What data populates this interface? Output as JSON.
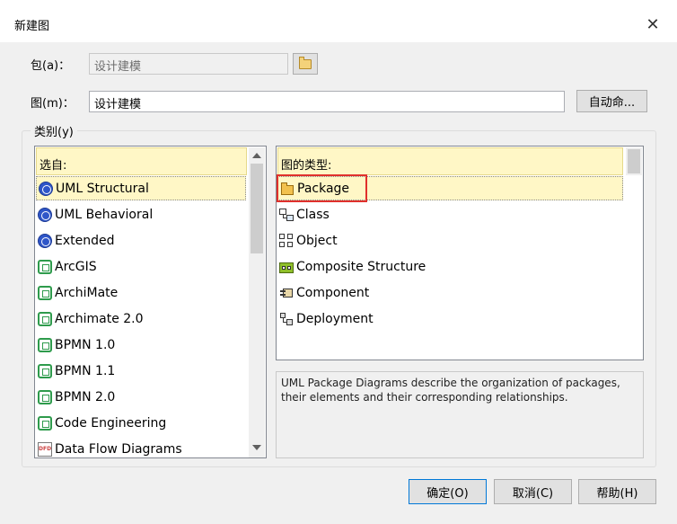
{
  "dialog": {
    "title": "新建图",
    "close_symbol": "✕"
  },
  "package": {
    "label": "包(a)：",
    "value": "设计建模"
  },
  "diagram": {
    "label": "图(m)：",
    "value": "设计建模",
    "auto_name_button": "自动命..."
  },
  "category": {
    "group_label": "类别(y)",
    "select_header": "选自:",
    "items": [
      {
        "label": "UML Structural",
        "icon": "uml-circle-icon",
        "selected": true
      },
      {
        "label": "UML Behavioral",
        "icon": "uml-circle-icon"
      },
      {
        "label": "Extended",
        "icon": "uml-circle-icon"
      },
      {
        "label": "ArcGIS",
        "icon": "technology-icon"
      },
      {
        "label": "ArchiMate",
        "icon": "technology-icon"
      },
      {
        "label": "Archimate 2.0",
        "icon": "technology-icon"
      },
      {
        "label": "BPMN 1.0",
        "icon": "technology-icon"
      },
      {
        "label": "BPMN 1.1",
        "icon": "technology-icon"
      },
      {
        "label": "BPMN 2.0",
        "icon": "technology-icon"
      },
      {
        "label": "Code Engineering",
        "icon": "technology-icon"
      },
      {
        "label": "Data Flow Diagrams",
        "icon": "dfd-icon"
      }
    ]
  },
  "diagram_types": {
    "header": "图的类型:",
    "items": [
      {
        "label": "Package",
        "icon": "package-icon",
        "selected": true
      },
      {
        "label": "Class",
        "icon": "class-icon"
      },
      {
        "label": "Object",
        "icon": "object-icon"
      },
      {
        "label": "Composite Structure",
        "icon": "composite-structure-icon"
      },
      {
        "label": "Component",
        "icon": "component-icon"
      },
      {
        "label": "Deployment",
        "icon": "deployment-icon"
      }
    ],
    "description": "UML Package Diagrams describe the organization of packages, their elements and their corresponding relationships."
  },
  "buttons": {
    "ok": "确定(O)",
    "cancel": "取消(C)",
    "help": "帮助(H)"
  },
  "colors": {
    "selection_bg": "#fff7c6",
    "highlight_border": "#e0302c",
    "default_button_border": "#0078d7"
  }
}
